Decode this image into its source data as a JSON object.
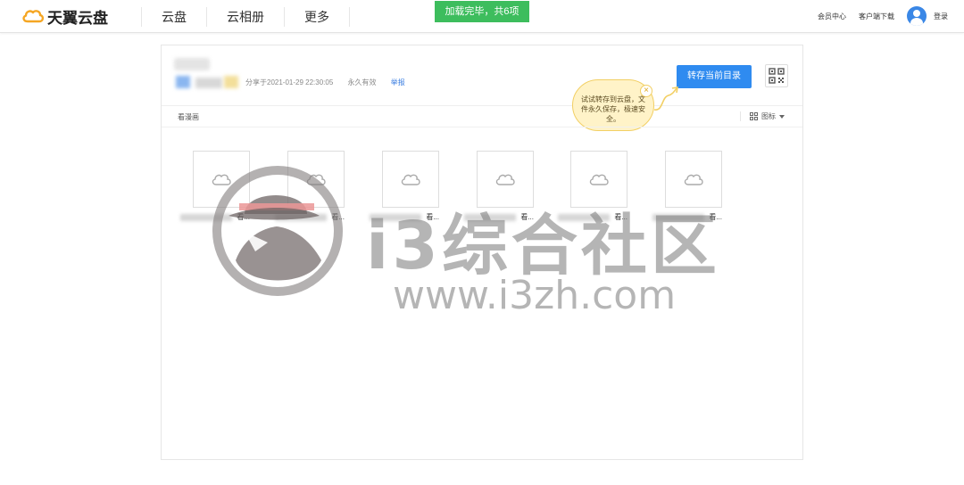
{
  "header": {
    "logo_text": "天翼云盘",
    "nav": [
      "云盘",
      "云相册",
      "更多"
    ],
    "toast": "加载完毕，共6项",
    "right_links": [
      "会员中心",
      "客户端下载"
    ],
    "login": "登录"
  },
  "share": {
    "date_label": "分享于2021-01-29 22:30:05",
    "validity": "永久有效",
    "report": "举报",
    "save_button": "转存当前目录",
    "tooltip": "试试转存到云盘，文件永久保存，极速安全。",
    "tooltip_close": "×"
  },
  "toolbar": {
    "crumb": "看漫画",
    "view_label": "图标"
  },
  "files": [
    {
      "name_suffix": "看..."
    },
    {
      "name_suffix": "看..."
    },
    {
      "name_suffix": "看..."
    },
    {
      "name_suffix": "看..."
    },
    {
      "name_suffix": "看..."
    },
    {
      "name_suffix": "看..."
    }
  ],
  "watermark": {
    "text_cn": "i3综合社区",
    "url": "www.i3zh.com"
  },
  "colors": {
    "accent": "#2f8bf0",
    "toast": "#3dbd5d",
    "bubble_bg": "#fff3c8",
    "bubble_border": "#f2cf63"
  }
}
